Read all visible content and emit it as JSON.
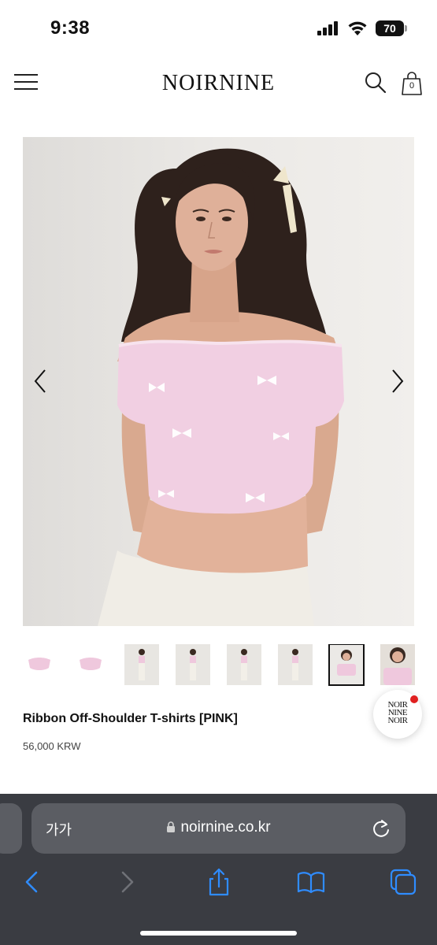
{
  "status_bar": {
    "time": "9:38",
    "battery": "70"
  },
  "header": {
    "logo": "NOIRNINE",
    "cart_count": "0"
  },
  "product": {
    "name": "Ribbon Off-Shoulder T-shirts [PINK]",
    "price": "56,000 KRW"
  },
  "fab": {
    "line1": "NOIR",
    "line2": "NINE",
    "line3": "NOIR"
  },
  "browser": {
    "text_size_label": "가가",
    "url": "noirnine.co.kr"
  },
  "colors": {
    "top_pink": "#f1cfe2",
    "accent_red": "#e02020",
    "ios_blue": "#2f8cff",
    "browser_bg": "#3a3c42"
  }
}
